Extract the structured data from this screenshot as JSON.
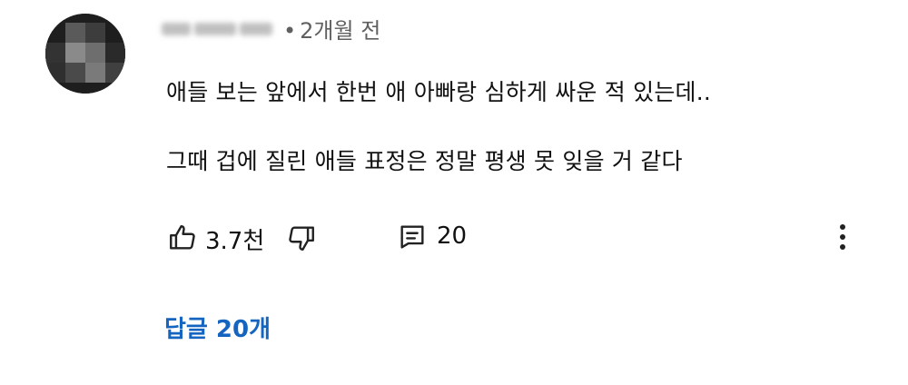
{
  "comment": {
    "time_ago": "2개월 전",
    "separator": "•",
    "lines": [
      "애들 보는 앞에서 한번 애 아빠랑 심하게 싸운 적 있는데..",
      "그때 겁에 질린 애들 표정은 정말 평생 못 잊을 거 같다"
    ],
    "like_count": "3.7천",
    "reply_count": "20",
    "replies_link": "답글 20개"
  },
  "icons": {
    "avatar": "avatar-icon",
    "like": "thumbs-up-icon",
    "dislike": "thumbs-down-icon",
    "reply": "comment-icon",
    "more": "more-vertical-icon"
  },
  "colors": {
    "link": "#1565c0",
    "meta": "#606060",
    "text": "#111111"
  }
}
